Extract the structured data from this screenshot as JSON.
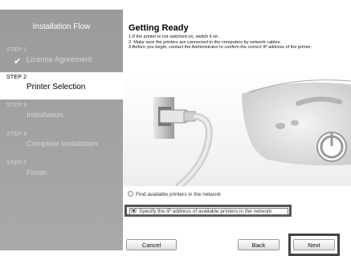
{
  "sidebar": {
    "title": "Installation Flow",
    "steps": [
      {
        "num": "STEP 1",
        "label": "License Agreement",
        "state": "done"
      },
      {
        "num": "STEP 2",
        "label": "Printer Selection",
        "state": "active"
      },
      {
        "num": "STEP 3",
        "label": "Installation",
        "state": "pending"
      },
      {
        "num": "STEP 4",
        "label": "Complete Installation",
        "state": "pending"
      },
      {
        "num": "STEP 5",
        "label": "Finish",
        "state": "pending"
      }
    ]
  },
  "main": {
    "title": "Getting Ready",
    "instructions": [
      "1.If the printer is not switched on, switch it on.",
      "2. Make sure the printers are connected to the computers by network cables.",
      "3.Before you begin, contact the Administrator to confirm the correct IP address of the printer."
    ],
    "options": [
      {
        "label": "Find available printers in the network",
        "selected": false
      },
      {
        "label": "Specify the IP address of available printers in the network",
        "selected": true
      }
    ]
  },
  "buttons": {
    "cancel": "Cancel",
    "back": "Back",
    "next": "Next"
  },
  "colors": {
    "sidebar_bg": "#a3a3a3",
    "active_step_bg": "#ffffff",
    "highlight_frame": "#555555"
  }
}
